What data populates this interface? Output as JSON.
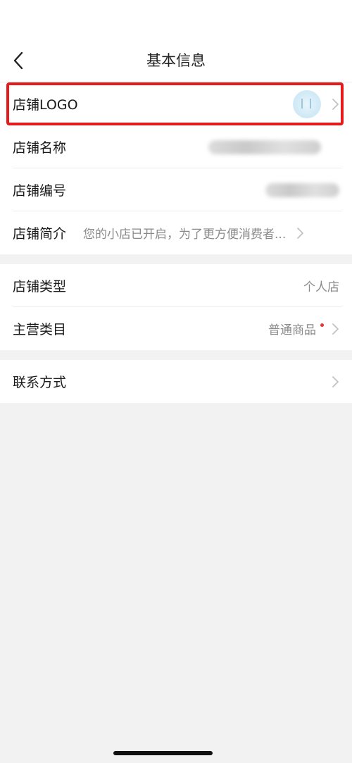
{
  "nav": {
    "title": "基本信息"
  },
  "group1": {
    "logo_label": "店铺LOGO",
    "name_label": "店铺名称",
    "number_label": "店铺编号",
    "intro_label": "店铺简介",
    "intro_value": "您的小店已开启，为了更方便消费者..."
  },
  "group2": {
    "type_label": "店铺类型",
    "type_value": "个人店",
    "category_label": "主营类目",
    "category_value": "普通商品"
  },
  "group3": {
    "contact_label": "联系方式"
  },
  "colors": {
    "highlight": "#e51b1b",
    "badge_dot": "#e53333"
  },
  "icons": [
    "back-arrow-icon",
    "chevron-right-icon",
    "shop-logo-image"
  ]
}
